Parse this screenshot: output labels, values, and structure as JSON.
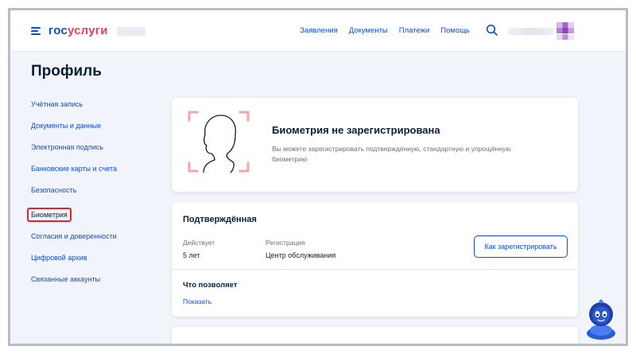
{
  "header": {
    "logo_part1": "гос",
    "logo_part2": "услуги",
    "nav": [
      "Заявления",
      "Документы",
      "Платежи",
      "Помощь"
    ]
  },
  "page_title": "Профиль",
  "sidebar": {
    "items": [
      {
        "label": "Учётная запись"
      },
      {
        "label": "Документы и данные"
      },
      {
        "label": "Электронная подпись"
      },
      {
        "label": "Банковские карты и счета"
      },
      {
        "label": "Безопасность"
      },
      {
        "label": "Биометрия",
        "active": true
      },
      {
        "label": "Согласия и доверенности"
      },
      {
        "label": "Цифровой архив"
      },
      {
        "label": "Связанные аккаунты"
      }
    ]
  },
  "biometry_card": {
    "title": "Биометрия не зарегистрирована",
    "description": "Вы можете зарегистрировать подтверждённую, стандартную и упрощённую биометрию"
  },
  "confirmed_card": {
    "title": "Подтверждённая",
    "valid_label": "Действует",
    "valid_value": "5 лет",
    "registration_label": "Регистрация",
    "registration_value": "Центр обслуживания",
    "register_button": "Как зарегистрировать",
    "allows_title": "Что позволяет",
    "show_link": "Показать"
  },
  "colors": {
    "brand_blue": "#0d4cd3",
    "brand_red": "#ee3f58",
    "highlight_red": "#e0242e",
    "page_bg": "#f1f4fa"
  }
}
